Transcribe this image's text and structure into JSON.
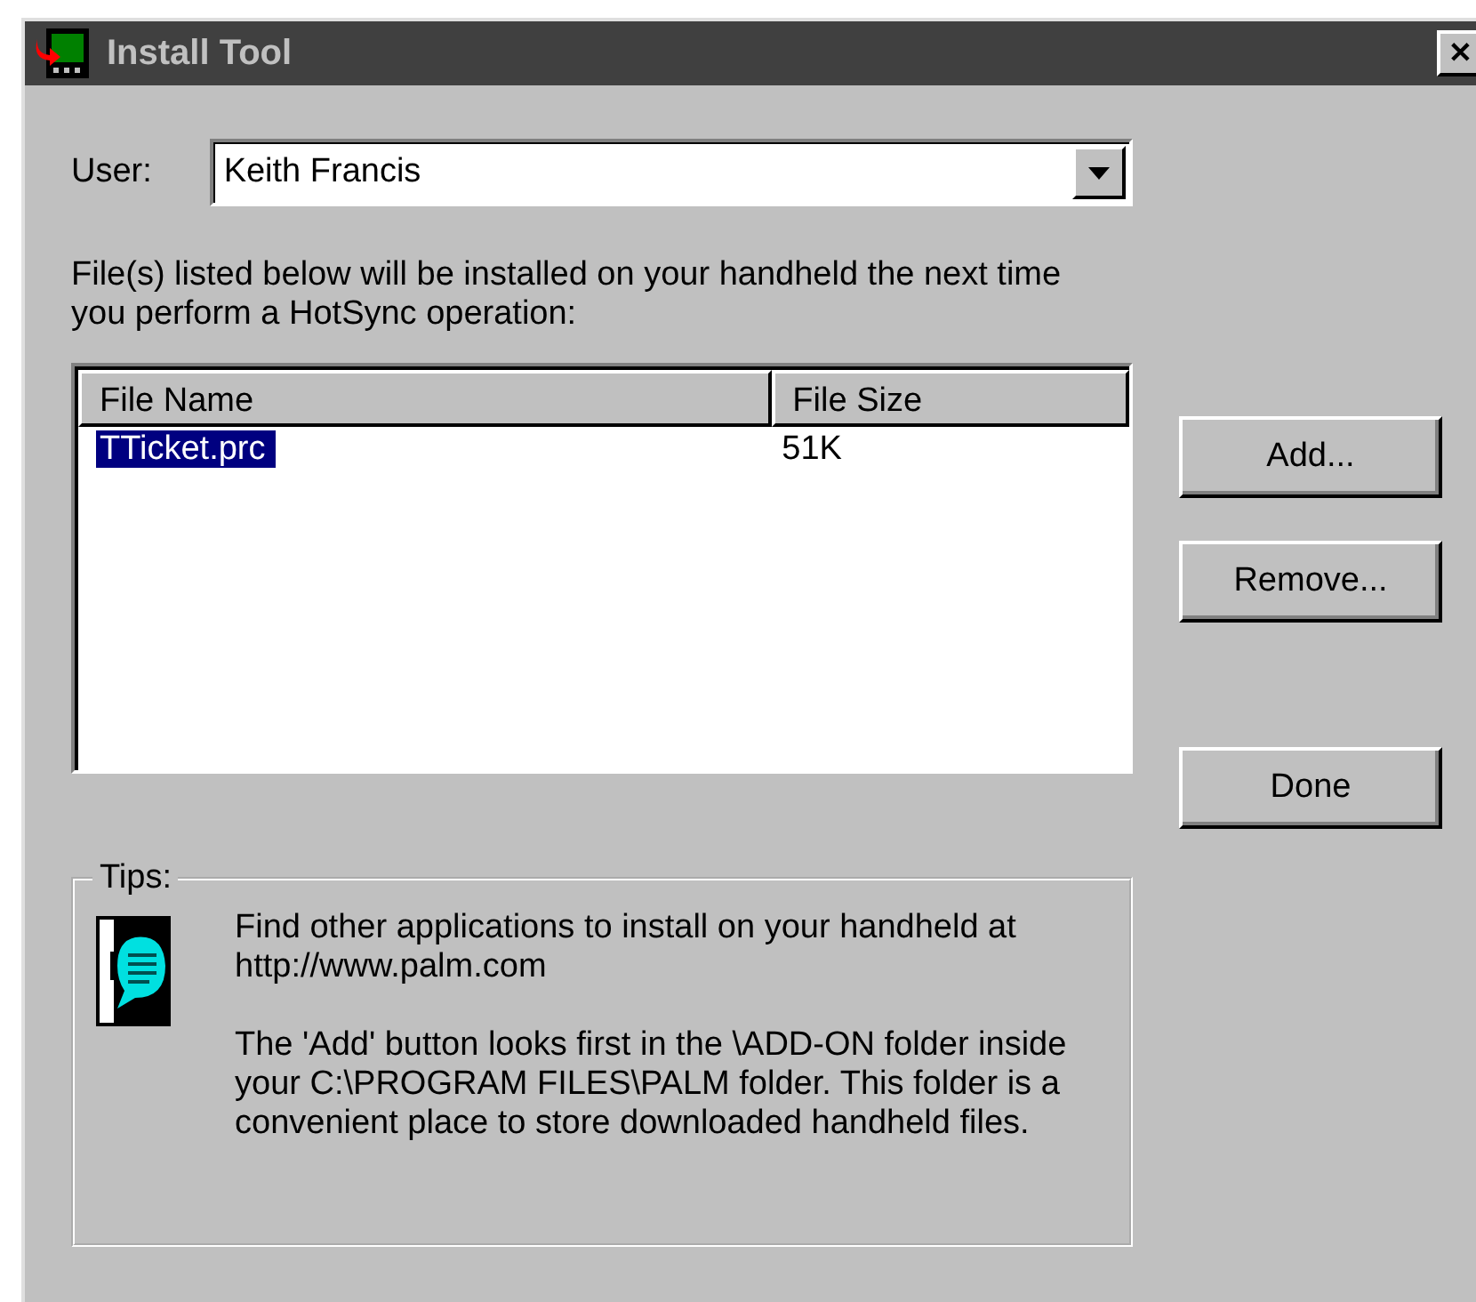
{
  "window": {
    "title": "Install Tool",
    "close": "✕"
  },
  "user": {
    "label": "User:",
    "value": "Keith Francis"
  },
  "intro": "File(s) listed below will be installed on your handheld the next time you perform a HotSync operation:",
  "table": {
    "columns": [
      "File Name",
      "File Size"
    ],
    "rows": [
      {
        "cells": [
          "TTicket.prc",
          "51K"
        ],
        "selected": true
      }
    ]
  },
  "buttons": [
    "Add...",
    "Remove...",
    "Done"
  ],
  "tips": {
    "title": "Tips:",
    "paragraphs": [
      "Find other applications to install on your handheld at http://www.palm.com",
      "The 'Add' button looks first in the \\ADD-ON folder inside your C:\\PROGRAM FILES\\PALM folder. This folder is a convenient place to store downloaded handheld files."
    ]
  }
}
